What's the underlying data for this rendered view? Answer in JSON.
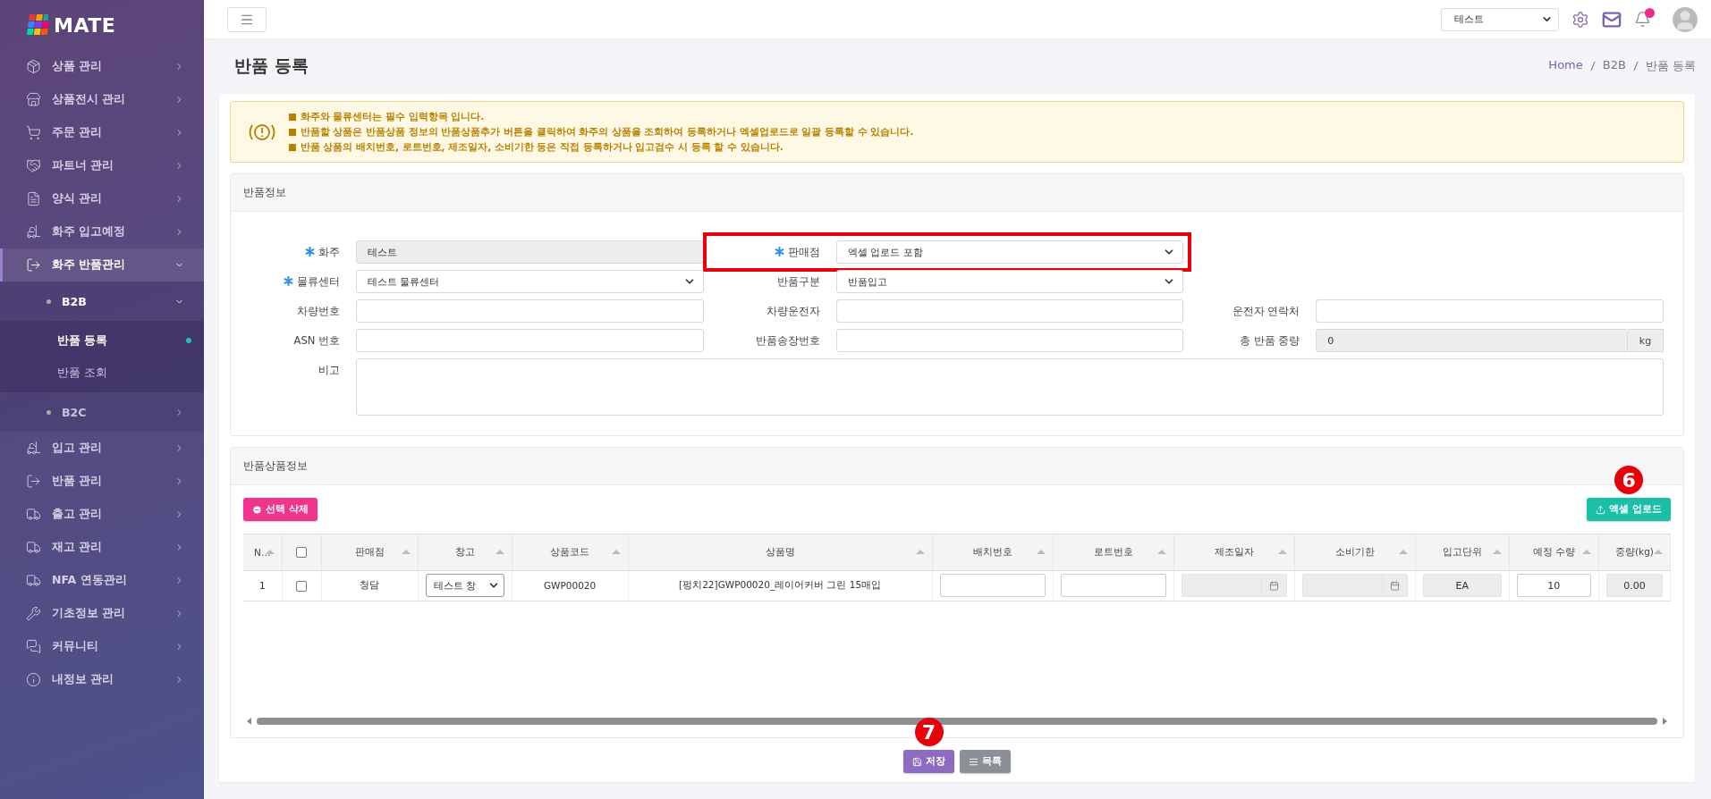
{
  "brand": {
    "name": "MATE"
  },
  "topbar": {
    "company_select": {
      "value": "테스트"
    },
    "notification_unread": true
  },
  "sidebar": {
    "items": [
      {
        "label": "상품 관리",
        "selected": false,
        "expanded": false
      },
      {
        "label": "상품전시 관리",
        "selected": false,
        "expanded": false
      },
      {
        "label": "주문 관리",
        "selected": false,
        "expanded": false
      },
      {
        "label": "파트너 관리",
        "selected": false,
        "expanded": false
      },
      {
        "label": "양식 관리",
        "selected": false,
        "expanded": false
      },
      {
        "label": "화주 입고예정",
        "selected": false,
        "expanded": false
      },
      {
        "label": "화주 반품관리",
        "selected": true,
        "expanded": true,
        "children": [
          {
            "label": "B2B",
            "selected": true,
            "expanded": true,
            "children": [
              {
                "label": "반품 등록",
                "selected": true
              },
              {
                "label": "반품 조회",
                "selected": false
              }
            ]
          },
          {
            "label": "B2C",
            "selected": false,
            "expanded": false
          }
        ]
      },
      {
        "label": "입고 관리",
        "selected": false,
        "expanded": false
      },
      {
        "label": "반품 관리",
        "selected": false,
        "expanded": false
      },
      {
        "label": "출고 관리",
        "selected": false,
        "expanded": false
      },
      {
        "label": "재고 관리",
        "selected": false,
        "expanded": false
      },
      {
        "label": "NFA 연동관리",
        "selected": false,
        "expanded": false
      },
      {
        "label": "기초정보 관리",
        "selected": false,
        "expanded": false
      },
      {
        "label": "커뮤니티",
        "selected": false,
        "expanded": false
      },
      {
        "label": "내정보 관리",
        "selected": false,
        "expanded": false
      }
    ]
  },
  "page": {
    "title": "반품 등록",
    "breadcrumb": [
      "Home",
      "B2B",
      "반품 등록"
    ]
  },
  "alert": {
    "lines": [
      "■ 화주와 물류센터는 필수 입력항목 입니다.",
      "■ 반품할 상품은 반품상품 정보의 반품상품추가 버튼을 클릭하여 화주의 상품을 조회하여 등록하거나 엑셀업로드로 일괄 등록할 수 있습니다.",
      "■ 반품 상품의 배치번호, 로트번호, 제조일자, 소비기한 등은 직접 등록하거나 입고검수 시 등록 할 수 있습니다."
    ]
  },
  "return_info": {
    "title": "반품정보",
    "rows": [
      [
        {
          "label": "화주",
          "kind": "readonly",
          "value": "테스트",
          "required": true
        },
        {
          "label": "판매점",
          "kind": "select",
          "value": "엑셀 업로드 포함",
          "required": true,
          "highlighted": true
        }
      ],
      [
        {
          "label": "물류센터",
          "kind": "select",
          "value": "테스트 물류센터",
          "required": true
        },
        {
          "label": "반품구분",
          "kind": "select",
          "value": "반품입고"
        }
      ],
      [
        {
          "label": "차량번호",
          "kind": "input"
        },
        {
          "label": "차량운전자",
          "kind": "input"
        },
        {
          "label": "운전자 연락처",
          "kind": "input"
        }
      ],
      [
        {
          "label": "ASN 번호",
          "kind": "input"
        },
        {
          "label": "반품송장번호",
          "kind": "input"
        },
        {
          "label": "총 반품 중량",
          "kind": "readonly",
          "value": "0",
          "unit": "kg"
        }
      ],
      [
        {
          "label": "비고",
          "kind": "textarea"
        }
      ]
    ]
  },
  "return_items": {
    "title": "반품상품정보",
    "delete_button": "선택 삭제",
    "upload_button": {
      "label": "엑셀 업로드",
      "callout": "6"
    },
    "columns": [
      {
        "label": "N…",
        "sortable": true
      },
      {
        "kind": "checkbox",
        "checked": false
      },
      {
        "label": "판매점",
        "sortable": true
      },
      {
        "label": "창고",
        "sortable": true
      },
      {
        "label": "상품코드",
        "sortable": true
      },
      {
        "label": "상품명",
        "sortable": true
      },
      {
        "label": "배치번호",
        "sortable": true
      },
      {
        "label": "로트번호",
        "sortable": true
      },
      {
        "label": "제조일자",
        "sortable": true
      },
      {
        "label": "소비기한",
        "sortable": true
      },
      {
        "label": "입고단위",
        "sortable": true
      },
      {
        "label": "예정 수량",
        "sortable": true
      },
      {
        "label": "중량(kg)",
        "sortable": true
      }
    ],
    "rows": [
      [
        {
          "kind": "text",
          "value": "1"
        },
        {
          "kind": "checkbox",
          "checked": false
        },
        {
          "kind": "text",
          "value": "청담"
        },
        {
          "kind": "select",
          "value": "테스트 창"
        },
        {
          "kind": "text",
          "value": "GWP00020"
        },
        {
          "kind": "text",
          "value": "[펑치22]GWP00020_레이어커버 그린 15매입"
        },
        {
          "kind": "input"
        },
        {
          "kind": "input"
        },
        {
          "kind": "date"
        },
        {
          "kind": "date"
        },
        {
          "kind": "readonly",
          "value": "EA"
        },
        {
          "kind": "input",
          "value": "10"
        },
        {
          "kind": "readonly",
          "value": "0.00"
        }
      ]
    ]
  },
  "actions": [
    {
      "label": "저장",
      "kind": "save",
      "callout": "7"
    },
    {
      "label": "목록",
      "kind": "list"
    }
  ]
}
